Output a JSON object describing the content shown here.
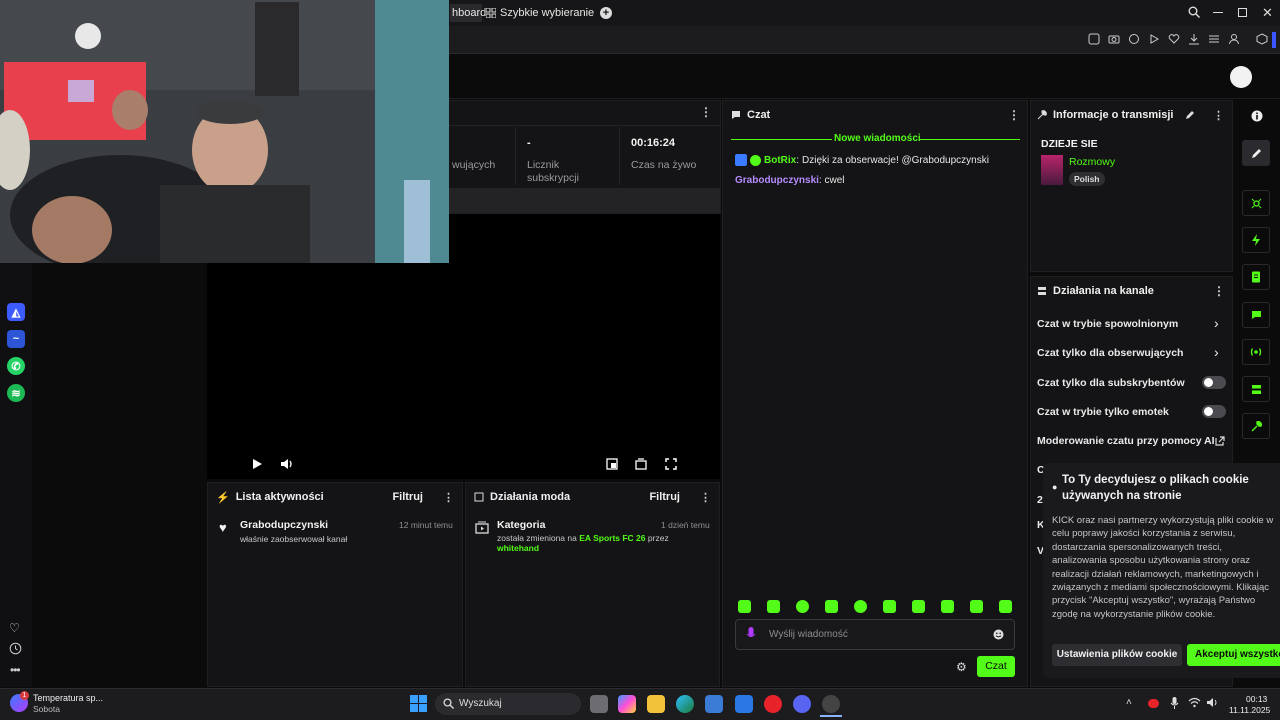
{
  "browser": {
    "tabs": [
      {
        "label": "hboard"
      },
      {
        "label": "Szybkie wybieranie"
      }
    ],
    "new_tab_label": "+"
  },
  "stats": {
    "followers_label": "wujących",
    "subs_value": "-",
    "subs_label": "Licznik subskrypcji",
    "live_value": "00:16:24",
    "live_label": "Czas na żywo"
  },
  "activity": {
    "title": "Lista aktywności",
    "filter_label": "Filtruj",
    "items": [
      {
        "user": "Grabodupczynski",
        "text": "właśnie zaobserwował kanał",
        "time": "12 minut temu"
      }
    ]
  },
  "mod_actions": {
    "title": "Działania moda",
    "filter_label": "Filtruj",
    "items": [
      {
        "title": "Kategoria",
        "time": "1 dzień temu",
        "text_prefix": "została zmieniona na",
        "category": "EA Sports FC 26",
        "text_by": "przez",
        "actor": "whitehand"
      }
    ]
  },
  "chat": {
    "title": "Czat",
    "new_messages_label": "Nowe wiadomości",
    "messages": [
      {
        "user": "BotRix",
        "text": "Dzięki za obserwacje! @Grabodupczynski",
        "color": "#53fc18"
      },
      {
        "user": "Grabodupczynski",
        "text": "cwel",
        "color": "#b68cff"
      }
    ],
    "input_placeholder": "Wyślij wiadomość",
    "send_label": "Czat"
  },
  "stream_info": {
    "title": "Informacje o transmisji",
    "stream_title": "DZIEJE SIE",
    "category": "Rozmowy",
    "language_tag": "Polish"
  },
  "channel_actions": {
    "title": "Działania na kanale",
    "rows": [
      {
        "label": "Czat w trybie spowolnionym",
        "control": "chevron"
      },
      {
        "label": "Czat tylko dla obserwujących",
        "control": "chevron"
      },
      {
        "label": "Czat tylko dla subskrybentów",
        "control": "toggle"
      },
      {
        "label": "Czat w trybie tylko emotek",
        "control": "toggle"
      },
      {
        "label": "Moderowanie czatu przy pomocy AI",
        "control": "external"
      }
    ],
    "partial_rows": [
      "C",
      "2",
      "K",
      "V"
    ]
  },
  "cookie": {
    "title": "To Ty decydujesz o plikach cookie używanych na stronie",
    "body": "KICK oraz nasi partnerzy wykorzystują pliki cookie w celu poprawy jakości korzystania z serwisu, dostarczania spersonalizowanych treści, analizowania sposobu użytkowania strony oraz realizacji działań reklamowych, marketingowych i związanych z mediami społecznościowymi. Klikając przycisk \"Akceptuj wszystko\", wyrażają Państwo zgodę na wykorzystanie plików cookie.",
    "settings_label": "Ustawienia plików cookie",
    "accept_label": "Akceptuj wszystko"
  },
  "taskbar": {
    "weather_title": "Temperatura sp...",
    "weather_sub": "Sobota",
    "weather_badge": "1",
    "search_placeholder": "Wyszukaj",
    "time": "00:13",
    "date": "11.11.2025"
  },
  "colors": {
    "kick_green": "#53fc18",
    "panel_bg": "#141416",
    "page_bg": "#0b0b0c"
  }
}
